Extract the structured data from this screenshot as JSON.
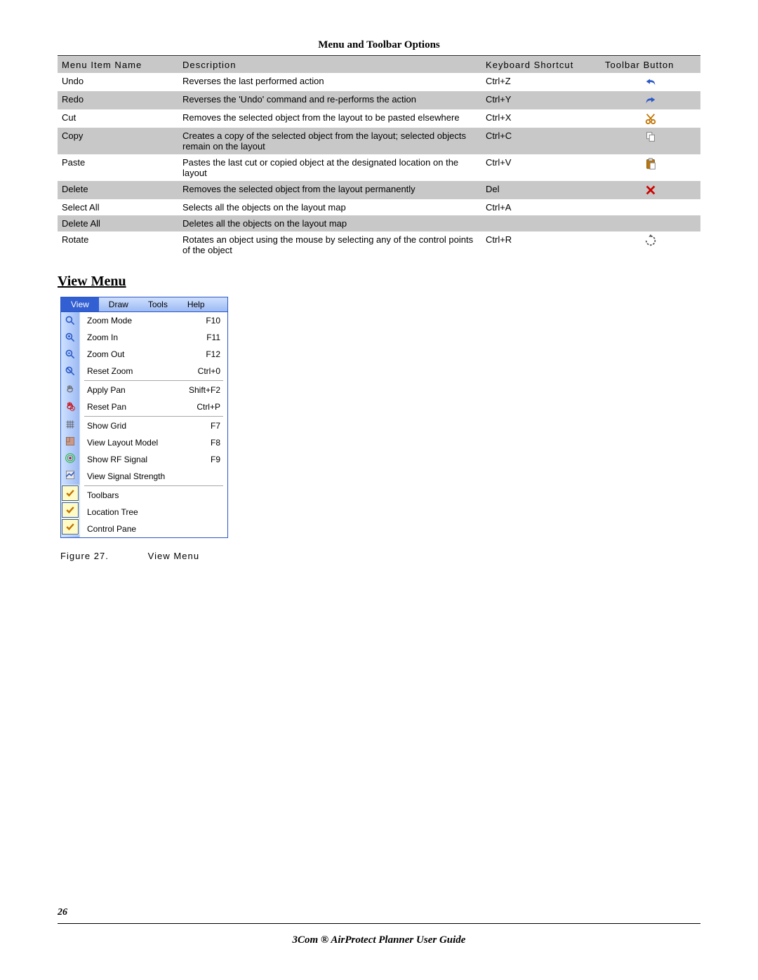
{
  "header": "Menu and Toolbar Options",
  "table": {
    "headers": [
      "Menu Item Name",
      "Description",
      "Keyboard Shortcut",
      "Toolbar Button"
    ],
    "rows": [
      {
        "name": "Undo",
        "desc": "Reverses the last performed action",
        "shortcut": "Ctrl+Z",
        "icon": "undo"
      },
      {
        "name": "Redo",
        "desc": "Reverses the 'Undo' command and re-performs the action",
        "shortcut": "Ctrl+Y",
        "icon": "redo"
      },
      {
        "name": "Cut",
        "desc": "Removes the selected object from the layout to be pasted elsewhere",
        "shortcut": "Ctrl+X",
        "icon": "cut"
      },
      {
        "name": "Copy",
        "desc": "Creates a copy of the selected object from the layout; selected objects remain on the layout",
        "shortcut": "Ctrl+C",
        "icon": "copy"
      },
      {
        "name": "Paste",
        "desc": "Pastes the last cut or copied object at the designated location on the layout",
        "shortcut": "Ctrl+V",
        "icon": "paste"
      },
      {
        "name": "Delete",
        "desc": "Removes the selected object from the layout permanently",
        "shortcut": "Del",
        "icon": "delete"
      },
      {
        "name": "Select All",
        "desc": "Selects all the objects on the layout map",
        "shortcut": "Ctrl+A",
        "icon": ""
      },
      {
        "name": "Delete All",
        "desc": "Deletes all the objects on the layout map",
        "shortcut": "",
        "icon": ""
      },
      {
        "name": "Rotate",
        "desc": "Rotates an object using the mouse by selecting any of the control points of the object",
        "shortcut": "Ctrl+R",
        "icon": "rotate"
      }
    ]
  },
  "section_heading": "View Menu",
  "menu": {
    "bar": [
      "View",
      "Draw",
      "Tools",
      "Help"
    ],
    "items": [
      {
        "icon": "zoom-mode",
        "label": "Zoom Mode",
        "shortcut": "F10"
      },
      {
        "icon": "zoom-in",
        "label": "Zoom In",
        "shortcut": "F11"
      },
      {
        "icon": "zoom-out",
        "label": "Zoom Out",
        "shortcut": "F12"
      },
      {
        "icon": "reset-zoom",
        "label": "Reset Zoom",
        "shortcut": "Ctrl+0"
      },
      {
        "sep": true
      },
      {
        "icon": "apply-pan",
        "label": "Apply Pan",
        "shortcut": "Shift+F2"
      },
      {
        "icon": "reset-pan",
        "label": "Reset Pan",
        "shortcut": "Ctrl+P"
      },
      {
        "sep": true
      },
      {
        "icon": "show-grid",
        "label": "Show Grid",
        "shortcut": "F7"
      },
      {
        "icon": "view-layout",
        "label": "View Layout Model",
        "shortcut": "F8"
      },
      {
        "icon": "show-rf",
        "label": "Show RF Signal",
        "shortcut": "F9"
      },
      {
        "icon": "view-signal",
        "label": "View Signal Strength",
        "shortcut": ""
      },
      {
        "sep": true
      },
      {
        "icon": "check",
        "label": "Toolbars",
        "shortcut": ""
      },
      {
        "icon": "check",
        "label": "Location Tree",
        "shortcut": ""
      },
      {
        "icon": "check",
        "label": "Control Pane",
        "shortcut": ""
      }
    ]
  },
  "caption": {
    "left": "Figure 27.",
    "right": "View Menu"
  },
  "page_number": "26",
  "footer": "3Com ® AirProtect Planner User Guide"
}
